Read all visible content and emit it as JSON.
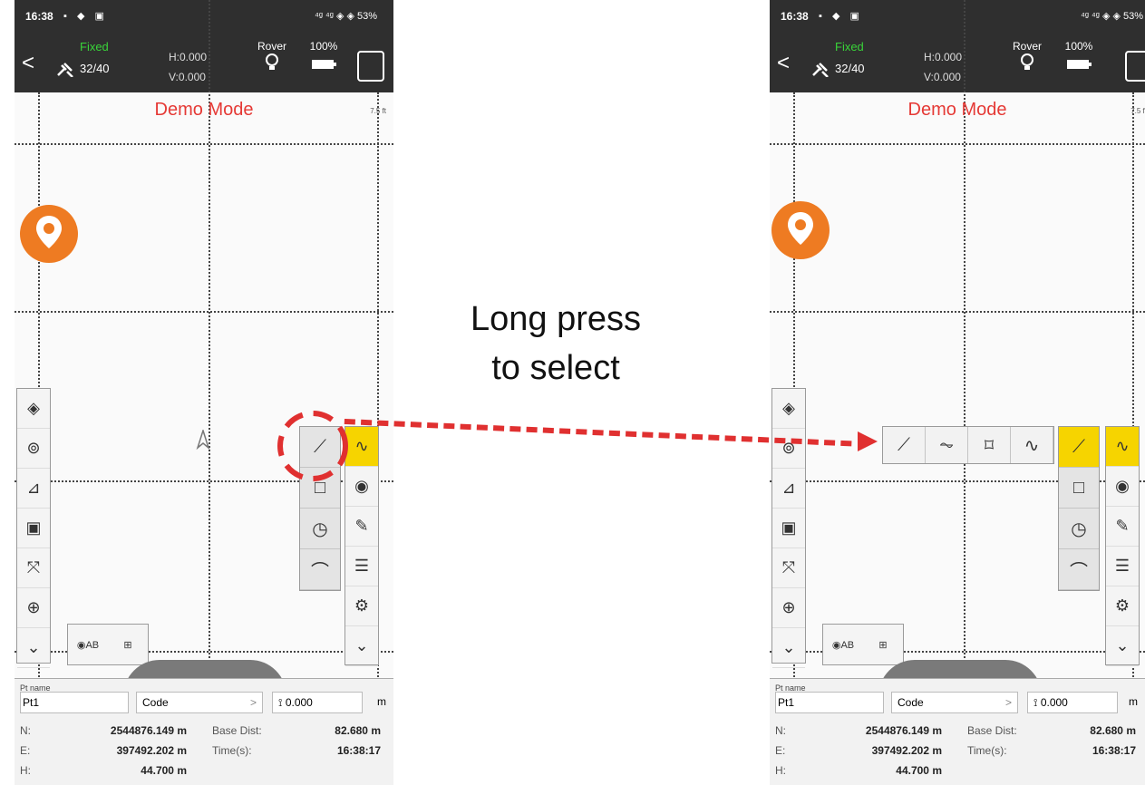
{
  "status": {
    "time": "16:38",
    "icons": "▪ ◆ ▣",
    "right": "⁴ᵍ ⁴ᵍ ◈ ◈ 53%"
  },
  "topbar": {
    "back": "<",
    "fix_status": "Fixed",
    "satellites": "32/40",
    "h_precision": "H:0.000",
    "v_precision": "V:0.000",
    "mode": "Rover",
    "battery": "100%"
  },
  "map": {
    "banner": "Demo Mode",
    "scale": "7.5 ft"
  },
  "left_toolbar": [
    "◈",
    "⊚",
    "⊿",
    "▣",
    "⤧",
    "⊕",
    "⌄"
  ],
  "right_toolbar": [
    "∿",
    "◉",
    "✎",
    "☰",
    "⚙",
    "⌄"
  ],
  "draw_column": [
    "⟋",
    "□",
    "◷",
    "⌒"
  ],
  "expanded_row": [
    "⟋",
    "⏦",
    "⌑",
    "∿"
  ],
  "chips": [
    "◉AB",
    "⊞"
  ],
  "panel": {
    "pt_name_label": "Pt name",
    "pt_name": "Pt1",
    "code_label": "Code",
    "antenna": "0.000",
    "unit": "m",
    "n_label": "N:",
    "n_value": "2544876.149 m",
    "e_label": "E:",
    "e_value": "397492.202 m",
    "h_label": "H:",
    "h_value": "44.700 m",
    "base_dist_label": "Base Dist:",
    "base_dist_value": "82.680 m",
    "time_label": "Time(s):",
    "time_value": "16:38:17"
  },
  "annotation": {
    "line1": "Long press",
    "line2": "to select"
  },
  "colors": {
    "accent_yellow": "#f6d400",
    "fix_green": "#39d339",
    "demo_red": "#e53935",
    "pin_orange": "#ee7b22",
    "annotation_red": "#e03030"
  }
}
